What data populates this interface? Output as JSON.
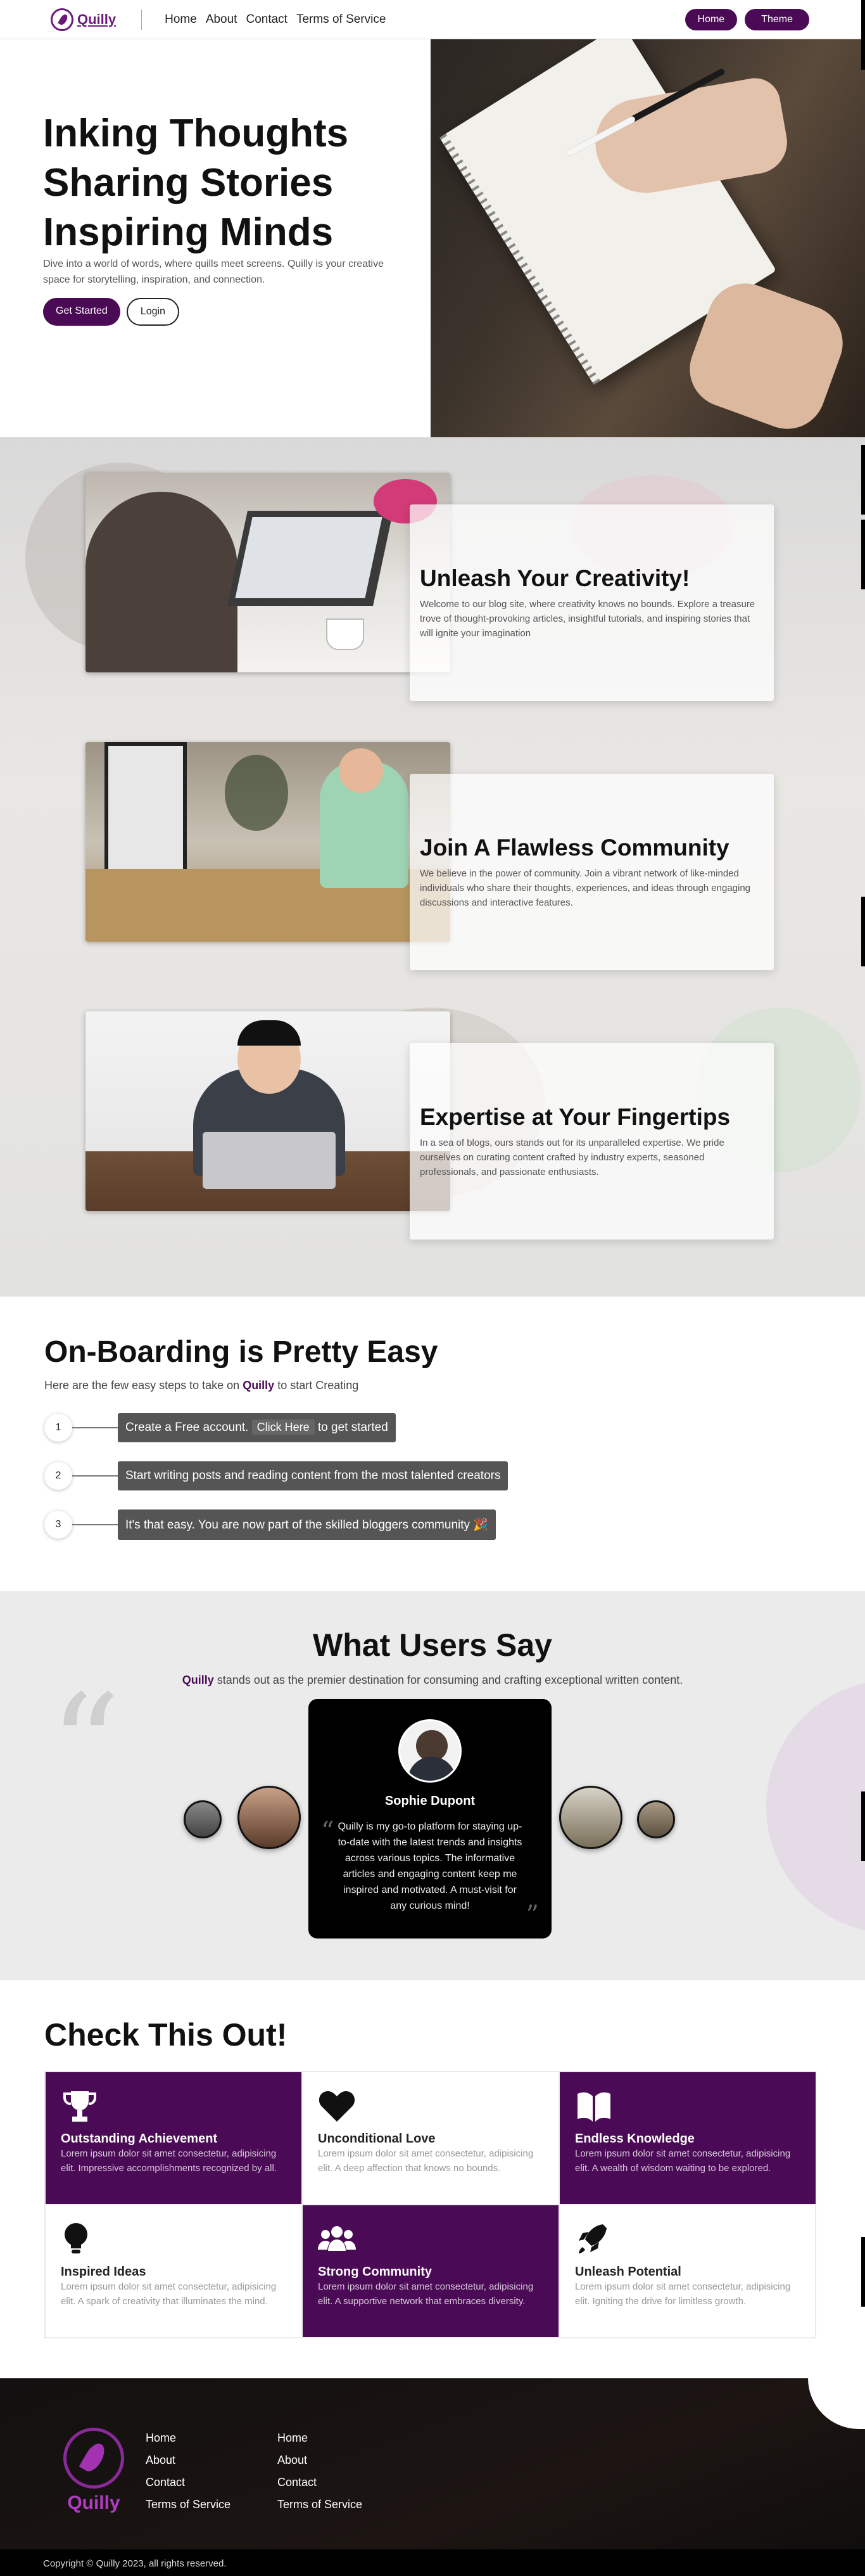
{
  "nav": {
    "logo_text": "Quilly",
    "links": [
      "Home",
      "About",
      "Contact",
      "Terms of Service"
    ],
    "home_button": "Home",
    "theme_button": "Theme"
  },
  "hero": {
    "title_line1": "Inking Thoughts",
    "title_line2": "Sharing Stories",
    "title_line3": "Inspiring Minds",
    "description": "Dive into a world of words, where quills meet screens. Quilly is your creative space for storytelling, inspiration, and connection.",
    "get_started": "Get Started",
    "login": "Login"
  },
  "features": [
    {
      "title": "Unleash Your Creativity!",
      "text": "Welcome to our blog site, where creativity knows no bounds. Explore a treasure trove of thought-provoking articles, insightful tutorials, and inspiring stories that will ignite your imagination"
    },
    {
      "title": "Join A Flawless Community",
      "text": "We believe in the power of community. Join a vibrant network of like-minded individuals who share their thoughts, experiences, and ideas through engaging discussions and interactive features."
    },
    {
      "title": "Expertise at Your Fingertips",
      "text": "In a sea of blogs, ours stands out for its unparalleled expertise. We pride ourselves on curating content crafted by industry experts, seasoned professionals, and passionate enthusiasts."
    }
  ],
  "onboarding": {
    "title": "On-Boarding is Pretty Easy",
    "sub_prefix": "Here are the few easy steps to take on",
    "sub_brand": "Quilly",
    "sub_suffix": "to start Creating",
    "steps": [
      {
        "num": "1",
        "before": "Create a Free account.",
        "key": "Click Here",
        "after": "to get started"
      },
      {
        "num": "2",
        "text": "Start writing posts and reading content from the most talented creators"
      },
      {
        "num": "3",
        "text": "It's that easy. You are now part of the skilled bloggers community 🎉"
      }
    ]
  },
  "testimonials": {
    "title": "What Users Say",
    "sub_brand": "Quilly",
    "sub_text": "stands out as the premier destination for consuming and crafting exceptional written content.",
    "name": "Sophie Dupont",
    "quote": "Quilly is my go-to platform for staying up-to-date with the latest trends and insights across various topics. The informative articles and engaging content keep me inspired and motivated. A must-visit for any curious mind!"
  },
  "check": {
    "title": "Check This Out!",
    "cards": [
      {
        "title": "Outstanding Achievement",
        "text": "Lorem ipsum dolor sit amet consectetur, adipisicing elit. Impressive accomplishments recognized by all.",
        "icon": "trophy-icon"
      },
      {
        "title": "Unconditional Love",
        "text": "Lorem ipsum dolor sit amet consectetur, adipisicing elit. A deep affection that knows no bounds.",
        "icon": "heart-icon"
      },
      {
        "title": "Endless Knowledge",
        "text": "Lorem ipsum dolor sit amet consectetur, adipisicing elit. A wealth of wisdom waiting to be explored.",
        "icon": "book-icon"
      },
      {
        "title": "Inspired Ideas",
        "text": "Lorem ipsum dolor sit amet consectetur, adipisicing elit. A spark of creativity that illuminates the mind.",
        "icon": "lightbulb-icon"
      },
      {
        "title": "Strong Community",
        "text": "Lorem ipsum dolor sit amet consectetur, adipisicing elit. A supportive network that embraces diversity.",
        "icon": "users-icon"
      },
      {
        "title": "Unleash Potential",
        "text": "Lorem ipsum dolor sit amet consectetur, adipisicing elit. Igniting the drive for limitless growth.",
        "icon": "rocket-icon"
      }
    ]
  },
  "footer": {
    "logo_text": "Quilly",
    "col1": [
      "Home",
      "About",
      "Contact",
      "Terms of Service"
    ],
    "col2": [
      "Home",
      "About",
      "Contact",
      "Terms of Service"
    ],
    "copyright": "Copyright © Quilly 2023, all rights reserved."
  },
  "colors": {
    "brand": "#4a0a55",
    "footer_logo": "#b03cc2"
  }
}
